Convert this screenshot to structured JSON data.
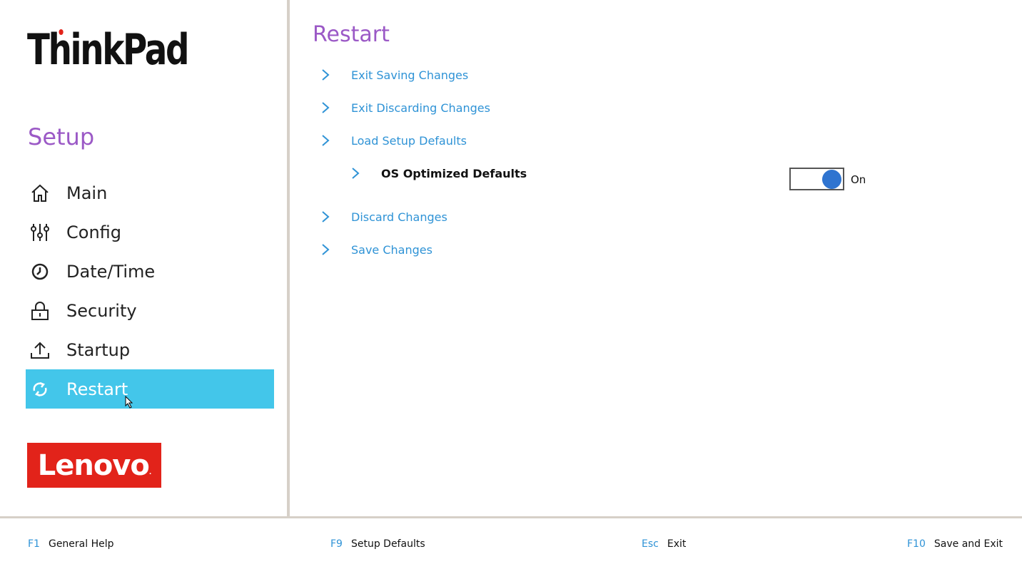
{
  "sidebar": {
    "brand": "ThinkPad",
    "title": "Setup",
    "items": [
      {
        "label": "Main",
        "icon": "home-icon"
      },
      {
        "label": "Config",
        "icon": "sliders-icon"
      },
      {
        "label": "Date/Time",
        "icon": "clock-icon"
      },
      {
        "label": "Security",
        "icon": "lock-icon"
      },
      {
        "label": "Startup",
        "icon": "upload-icon"
      },
      {
        "label": "Restart",
        "icon": "refresh-icon",
        "active": true
      }
    ],
    "vendor_logo": "Lenovo"
  },
  "main": {
    "title": "Restart",
    "items": [
      {
        "label": "Exit Saving Changes"
      },
      {
        "label": "Exit Discarding Changes"
      },
      {
        "label": "Load Setup Defaults"
      },
      {
        "label": "OS Optimized Defaults",
        "toggle": "On"
      },
      {
        "label": "Discard Changes"
      },
      {
        "label": "Save Changes"
      }
    ]
  },
  "footer": {
    "keys": [
      {
        "key": "F1",
        "desc": "General Help"
      },
      {
        "key": "F9",
        "desc": "Setup Defaults"
      },
      {
        "key": "Esc",
        "desc": "Exit"
      },
      {
        "key": "F10",
        "desc": "Save and Exit"
      }
    ]
  },
  "colors": {
    "accent_purple": "#9b59c6",
    "link_blue": "#2f93d6",
    "active_bg": "#43c6ea",
    "lenovo_red": "#e2231a",
    "toggle_knob": "#2f74d0"
  }
}
